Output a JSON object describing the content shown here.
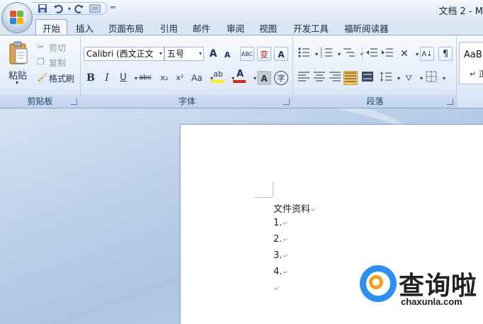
{
  "window": {
    "title": "文档 2 - M"
  },
  "qat": {
    "save_icon": "save-icon",
    "undo_icon": "undo-icon",
    "redo_icon": "redo-icon",
    "print_preview_icon": "print-preview-icon"
  },
  "tabs": [
    {
      "label": "开始",
      "active": true
    },
    {
      "label": "插入"
    },
    {
      "label": "页面布局"
    },
    {
      "label": "引用"
    },
    {
      "label": "邮件"
    },
    {
      "label": "审阅"
    },
    {
      "label": "视图"
    },
    {
      "label": "开发工具"
    },
    {
      "label": "福昕阅读器"
    }
  ],
  "clipboard": {
    "paste": "粘贴",
    "cut": "剪切",
    "copy": "复制",
    "format_painter": "格式刷",
    "group_label": "剪贴板"
  },
  "font": {
    "family": "Calibri (西文正文",
    "size": "五号",
    "grow": "A",
    "shrink": "A",
    "clear_format": "ABC",
    "phonetic": "变",
    "border": "A",
    "bold": "B",
    "italic": "I",
    "underline": "U",
    "strikethrough": "abc",
    "subscript": "x₂",
    "superscript": "x²",
    "change_case": "Aa",
    "highlight": "ab",
    "font_color": "A",
    "shading": "A",
    "enclose": "字",
    "group_label": "字体"
  },
  "paragraph": {
    "group_label": "段落"
  },
  "styles": {
    "preview": "AaBb",
    "preview2": "↵ 正"
  },
  "document": {
    "lines": [
      "文件资料",
      "1.",
      "2.",
      "3.",
      "4.",
      ""
    ]
  },
  "watermark": {
    "title": "查询啦",
    "url": "chaxunla.com"
  },
  "colors": {
    "accent": "#2d8ff0",
    "highlight": "#ffee00",
    "font_color": "#e0201b"
  }
}
